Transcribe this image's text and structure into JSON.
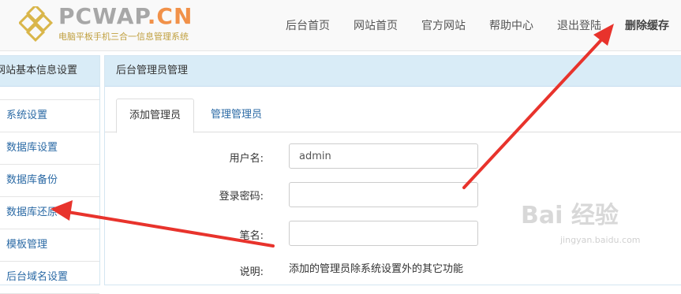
{
  "header": {
    "logo_text_main": "PCWAP",
    "logo_text_dot": ".",
    "logo_text_cn": "CN",
    "logo_subtitle": "电脑平板手机三合一信息管理系统",
    "nav": [
      {
        "label": "后台首页"
      },
      {
        "label": "网站首页"
      },
      {
        "label": "官方网站"
      },
      {
        "label": "帮助中心"
      },
      {
        "label": "退出登陆"
      },
      {
        "label": "删除缓存"
      }
    ]
  },
  "sidebar": {
    "title": "网站基本信息设置",
    "items": [
      {
        "label": "系统设置"
      },
      {
        "label": "数据库设置"
      },
      {
        "label": "数据库备份"
      },
      {
        "label": "数据库还原"
      },
      {
        "label": "模板管理"
      },
      {
        "label": "后台域名设置"
      }
    ]
  },
  "main": {
    "title": "后台管理员管理",
    "tabs": [
      {
        "label": "添加管理员",
        "active": true
      },
      {
        "label": "管理管理员",
        "active": false
      }
    ],
    "form": {
      "username_label": "用户名:",
      "username_value": "admin",
      "password_label": "登录密码:",
      "password_value": "",
      "nickname_label": "笔名:",
      "nickname_value": "",
      "note_label": "说明:",
      "note_text": "添加的管理员除系统设置外的其它功能"
    }
  },
  "watermark": {
    "main": "Bai 经验",
    "sub": "jingyan.baidu.com"
  },
  "colors": {
    "panel_header_bg": "#d9ecf7",
    "link_blue": "#2b6aa5",
    "arrow_red": "#e8332c",
    "logo_orange": "#f19149"
  }
}
